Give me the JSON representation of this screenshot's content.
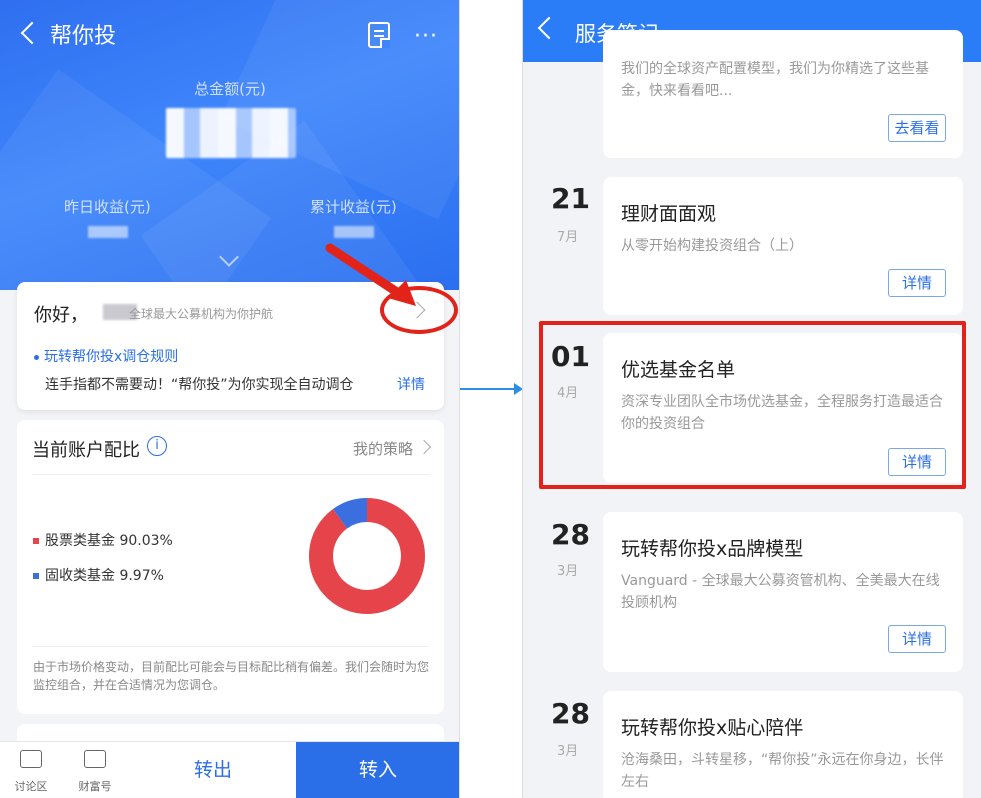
{
  "left": {
    "nav_title": "帮你投",
    "more_glyph": "···",
    "total_label": "总金额(元)",
    "yesterday_label": "昨日收益(元)",
    "cumulative_label": "累计收益(元)",
    "hello": {
      "greeting": "你好，",
      "subtitle": "全球最大公募机构为你护航",
      "rule_link": "玩转帮你投x调仓规则",
      "rule_desc": "连手指都不需要动！“帮你投”为你实现全自动调仓",
      "rule_more": "详情"
    },
    "allocation": {
      "title": "当前账户配比",
      "info_glyph": "i",
      "strategy": "我的策略",
      "items": [
        {
          "label": "股票类基金 90.03%",
          "percent": 90.03,
          "color": "#e5454a"
        },
        {
          "label": "固收类基金 9.97%",
          "percent": 9.97,
          "color": "#3b6fe0"
        }
      ],
      "note": "由于市场价格变动，目前配比可能会与目标配比稍有偏差。我们会随时为您监控组合，并在合适情况为您调仓。"
    },
    "bottom": {
      "tab1": "讨论区",
      "tab2": "财富号",
      "out": "转出",
      "in": "转入"
    }
  },
  "right": {
    "nav_title": "服务笔记",
    "cards": [
      {
        "desc": "我们的全球资产配置模型，我们为你精选了这些基金，快来看看吧...",
        "button": "去看看"
      },
      {
        "day": "21",
        "month": "7月",
        "title": "理财面面观",
        "desc": "从零开始构建投资组合（上）",
        "button": "详情"
      },
      {
        "day": "01",
        "month": "4月",
        "title": "优选基金名单",
        "desc": "资深专业团队全市场优选基金，全程服务打造最适合你的投资组合",
        "button": "详情"
      },
      {
        "day": "28",
        "month": "3月",
        "title": "玩转帮你投x品牌模型",
        "desc": "Vanguard - 全球最大公募资管机构、全美最大在线投顾机构",
        "button": "详情"
      },
      {
        "day": "28",
        "month": "3月",
        "title": "玩转帮你投x贴心陪伴",
        "desc": "沧海桑田，斗转星移，“帮你投”永远在你身边，长伴左右"
      }
    ]
  }
}
